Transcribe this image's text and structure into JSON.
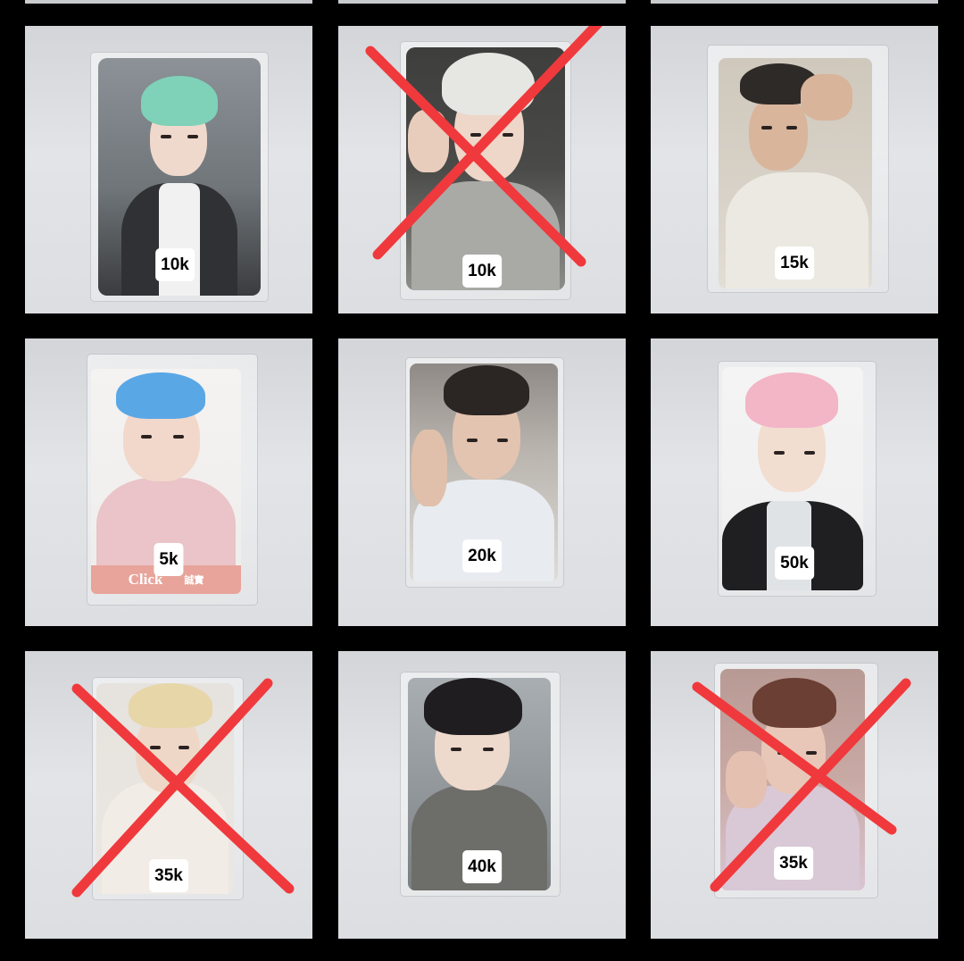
{
  "gallery": {
    "cards": [
      {
        "price": "10k",
        "sold_out": false,
        "hair_color": "#7fd1b8",
        "bg_color": "#7d8286",
        "outfit_color": "#2f3134"
      },
      {
        "price": "10k",
        "sold_out": true,
        "hair_color": "#e6e6e2",
        "bg_color": "#4a4a48",
        "outfit_color": "#a9aaa6"
      },
      {
        "price": "15k",
        "sold_out": false,
        "hair_color": "#2e2a28",
        "bg_color": "#d6d0c6",
        "outfit_color": "#ece9e2"
      },
      {
        "price": "5k",
        "sold_out": false,
        "hair_color": "#5aa7e6",
        "bg_color": "#f2f0ee",
        "outfit_color": "#eac4c8",
        "footer_brand": "Click",
        "footer_sub": "誠實"
      },
      {
        "price": "20k",
        "sold_out": false,
        "hair_color": "#2b2524",
        "bg_color": "#cfcac4",
        "outfit_color": "#e8ebef"
      },
      {
        "price": "50k",
        "sold_out": false,
        "hair_color": "#f2b6c6",
        "bg_color": "#f3f3f3",
        "outfit_color": "#1f1f21"
      },
      {
        "price": "35k",
        "sold_out": true,
        "hair_color": "#e7d6a8",
        "bg_color": "#e5e1dc",
        "outfit_color": "#f1ece6"
      },
      {
        "price": "40k",
        "sold_out": false,
        "hair_color": "#1f1d1f",
        "bg_color": "#9aa0a3",
        "outfit_color": "#6d6e69"
      },
      {
        "price": "35k",
        "sold_out": true,
        "hair_color": "#6b3f33",
        "bg_color": "#c9a9a4",
        "outfit_color": "#d9c8d6"
      }
    ],
    "sold_mark_color": "#f0393c",
    "badge_color": "#ffffff"
  }
}
